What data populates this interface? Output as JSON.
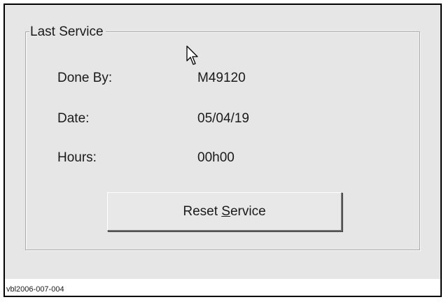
{
  "group": {
    "title": "Last Service"
  },
  "fields": {
    "done_by_label": "Done By:",
    "done_by_value": "M49120",
    "date_label": "Date:",
    "date_value": "05/04/19",
    "hours_label": "Hours:",
    "hours_value": "00h00"
  },
  "button": {
    "reset_pre": "Reset ",
    "reset_mnemonic": "S",
    "reset_post": "ervice"
  },
  "caption": "vbl2006-007-004",
  "icons": {
    "cursor": "mouse-pointer-icon"
  },
  "colors": {
    "panel_bg": "#e6e6e6",
    "frame_border": "#000000"
  }
}
